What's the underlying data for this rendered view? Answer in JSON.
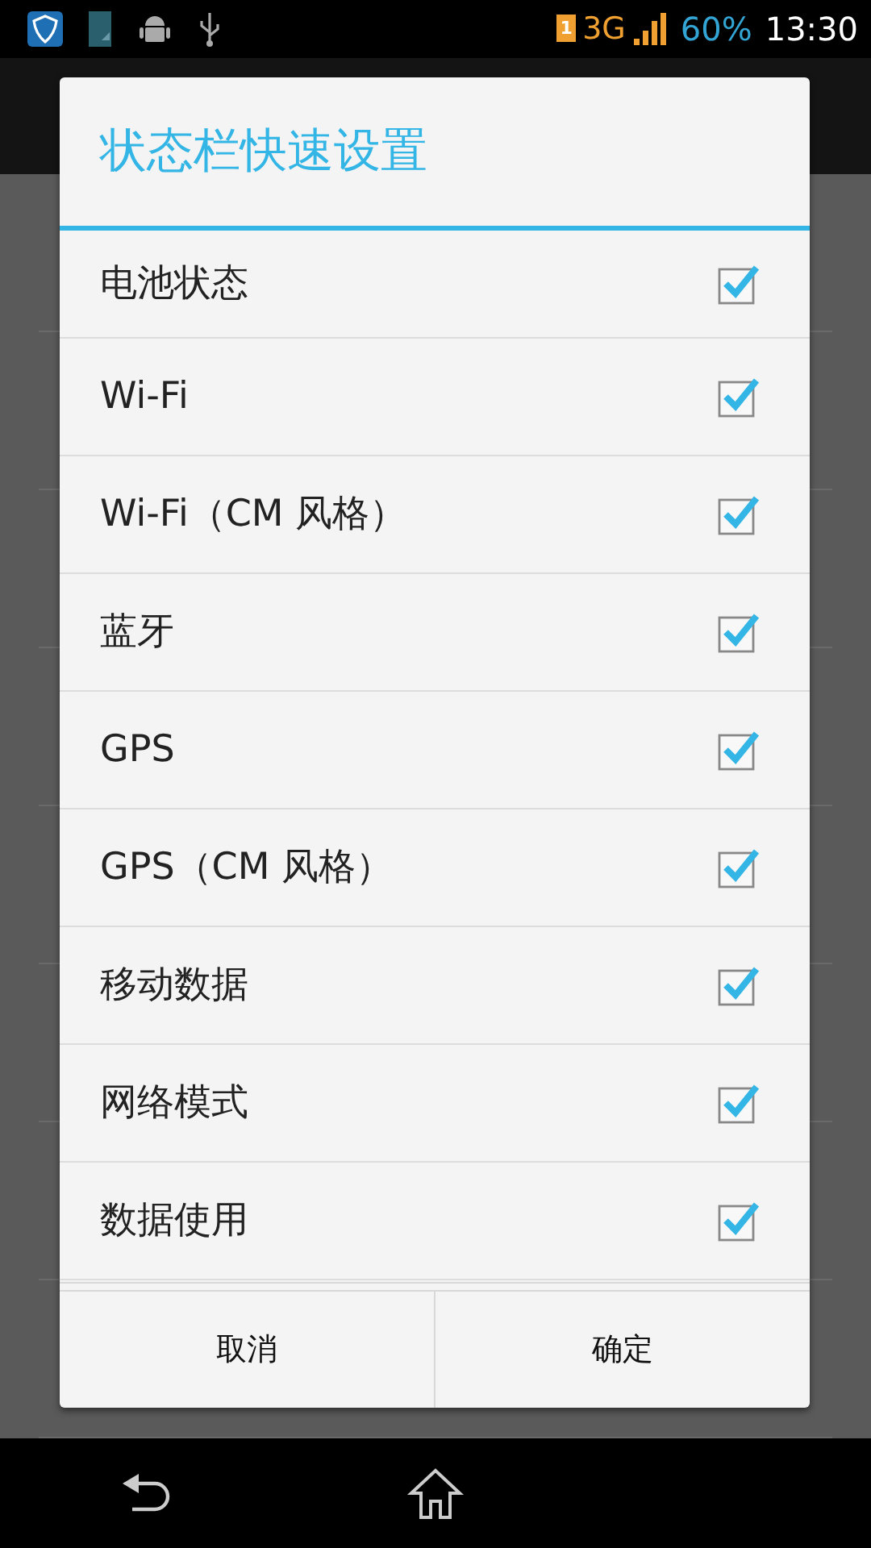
{
  "status_bar": {
    "sim": "1",
    "network": "3G",
    "battery": "60%",
    "time": "13:30"
  },
  "dialog": {
    "title": "状态栏快速设置",
    "items": [
      {
        "label": "电池状态",
        "checked": true
      },
      {
        "label": "Wi-Fi",
        "checked": true
      },
      {
        "label": "Wi-Fi（CM 风格）",
        "checked": true
      },
      {
        "label": "蓝牙",
        "checked": true
      },
      {
        "label": "GPS",
        "checked": true
      },
      {
        "label": "GPS（CM 风格）",
        "checked": true
      },
      {
        "label": "移动数据",
        "checked": true
      },
      {
        "label": "网络模式",
        "checked": true
      },
      {
        "label": "数据使用",
        "checked": true
      }
    ],
    "buttons": [
      "取消",
      "确定"
    ]
  }
}
